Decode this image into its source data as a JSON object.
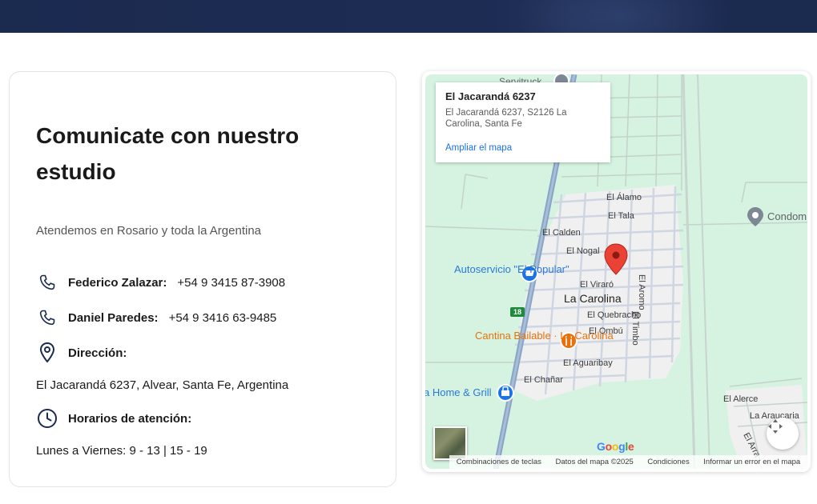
{
  "contact": {
    "title": "Comunicate con nuestro estudio",
    "subtitle": "Atendemos en Rosario y toda la Argentina",
    "phones": [
      {
        "label": "Federico Zalazar:",
        "value": "+54 9 3415 87-3908",
        "icon": "phone-icon"
      },
      {
        "label": "Daniel Paredes:",
        "value": "+54 9 3416 63-9485",
        "icon": "phone-icon"
      }
    ],
    "address_label": "Dirección:",
    "address_value": "El Jacarandá 6237, Alvear, Santa Fe, Argentina",
    "hours_label": "Horarios de atención:",
    "hours_value": "Lunes a Viernes: 9 - 13 | 15 - 19"
  },
  "map": {
    "info_window": {
      "title": "El Jacarandá 6237",
      "address": "El Jacarandá 6237, S2126 La Carolina, Santa Fe",
      "link": "Ampliar el mapa"
    },
    "town": "La Carolina",
    "streets": [
      "El Álamo",
      "El Tala",
      "El Calden",
      "El Nogal",
      "El Viraró",
      "El Quebracho",
      "El Ombú",
      "El Aguaribay",
      "El Chañar",
      "El Aromo",
      "El Timbo",
      "El Alerce",
      "La Araucaria",
      "El Arra"
    ],
    "pois": {
      "autoservicio": "Autoservicio \"El Popular\"",
      "cantina": "Cantina Bailable · La Carolina",
      "home_grill": "a Home & Grill",
      "servitruck": "Servitruck",
      "condom": "Condom"
    },
    "route": "18",
    "google_logo": [
      "G",
      "o",
      "o",
      "g",
      "l",
      "e"
    ],
    "attribution": [
      "Combinaciones de teclas",
      "Datos del mapa ©2025",
      "Condiciones",
      "Informar un error en el mapa"
    ]
  },
  "colors": {
    "header_bg": "#1b2a4f",
    "icon_navy": "#1b2a4f",
    "map_green": "#d5f3e0",
    "map_pin": "#ea4335",
    "link_blue": "#1a73e8"
  }
}
